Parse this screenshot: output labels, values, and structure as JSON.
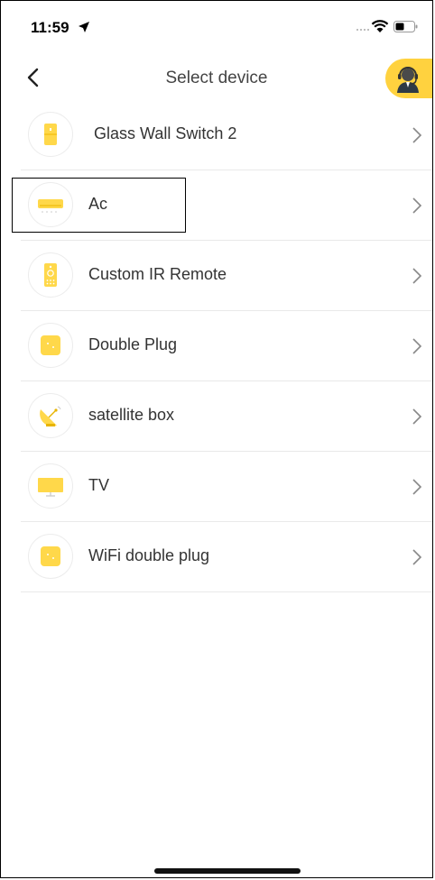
{
  "status_bar": {
    "time": "11:59",
    "icons": [
      "location-arrow-icon",
      "signal-dots-icon",
      "wifi-icon",
      "battery-icon"
    ]
  },
  "nav": {
    "title": "Select device",
    "back_icon": "chevron-left-icon",
    "support_icon": "customer-support-icon"
  },
  "devices": [
    {
      "label": "Glass Wall Switch 2",
      "icon": "wall-switch-icon"
    },
    {
      "label": "Ac",
      "icon": "air-conditioner-icon"
    },
    {
      "label": "Custom IR Remote",
      "icon": "ir-remote-icon"
    },
    {
      "label": "Double Plug",
      "icon": "double-plug-icon"
    },
    {
      "label": "satellite box",
      "icon": "satellite-dish-icon"
    },
    {
      "label": "TV",
      "icon": "tv-icon"
    },
    {
      "label": "WiFi double plug",
      "icon": "wifi-double-plug-icon"
    }
  ],
  "colors": {
    "accent": "#ffd23f",
    "icon_yellow": "#ffd84a",
    "divider": "#e9e9e9",
    "text": "#333333",
    "chevron": "#888888"
  }
}
